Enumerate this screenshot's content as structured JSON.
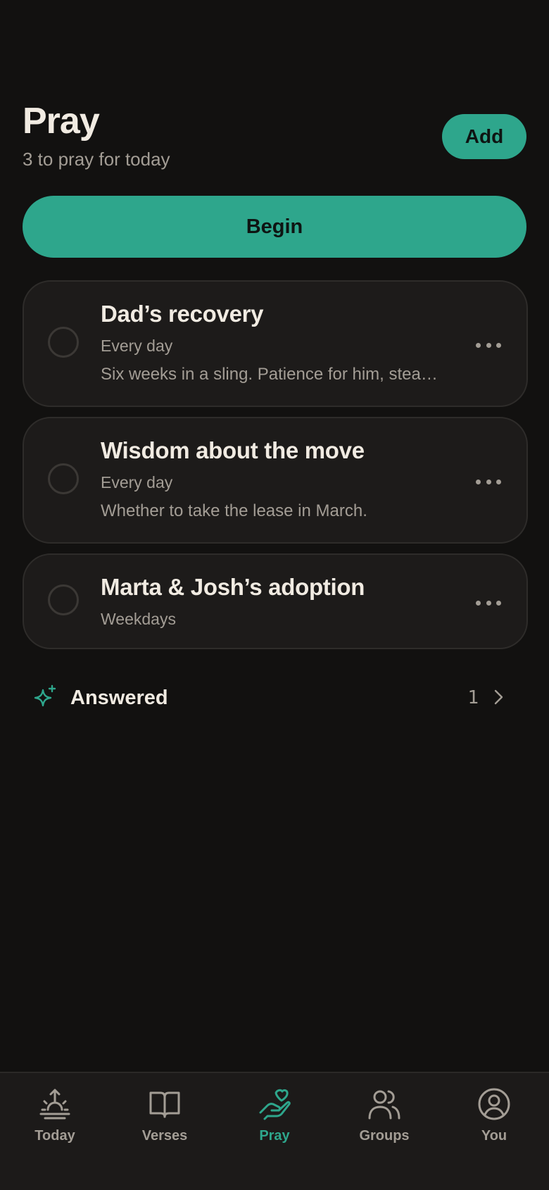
{
  "header": {
    "title": "Pray",
    "subtitle": "3 to pray for today",
    "add_label": "Add"
  },
  "begin_label": "Begin",
  "prayers": [
    {
      "title": "Dad’s recovery",
      "schedule": "Every day",
      "note": "Six weeks in a sling. Patience for him, stea…",
      "done": false
    },
    {
      "title": "Wisdom about the move",
      "schedule": "Every day",
      "note": "Whether to take the lease in March.",
      "done": false
    },
    {
      "title": "Marta & Josh’s adoption",
      "schedule": "Weekdays",
      "done": false
    }
  ],
  "answered": {
    "label": "Answered",
    "count": "1",
    "icon": "sparkle-icon"
  },
  "tabs": [
    {
      "label": "Today",
      "icon": "sunrise-icon",
      "active": false
    },
    {
      "label": "Verses",
      "icon": "book-icon",
      "active": false
    },
    {
      "label": "Pray",
      "icon": "hand-heart-icon",
      "active": true
    },
    {
      "label": "Groups",
      "icon": "users-icon",
      "active": false
    },
    {
      "label": "You",
      "icon": "user-circle-icon",
      "active": false
    }
  ],
  "colors": {
    "background": "#121110",
    "card": "#1d1b1a",
    "accent": "#2ea68c",
    "text_primary": "#f1ebe2",
    "text_secondary": "#a39d95"
  }
}
